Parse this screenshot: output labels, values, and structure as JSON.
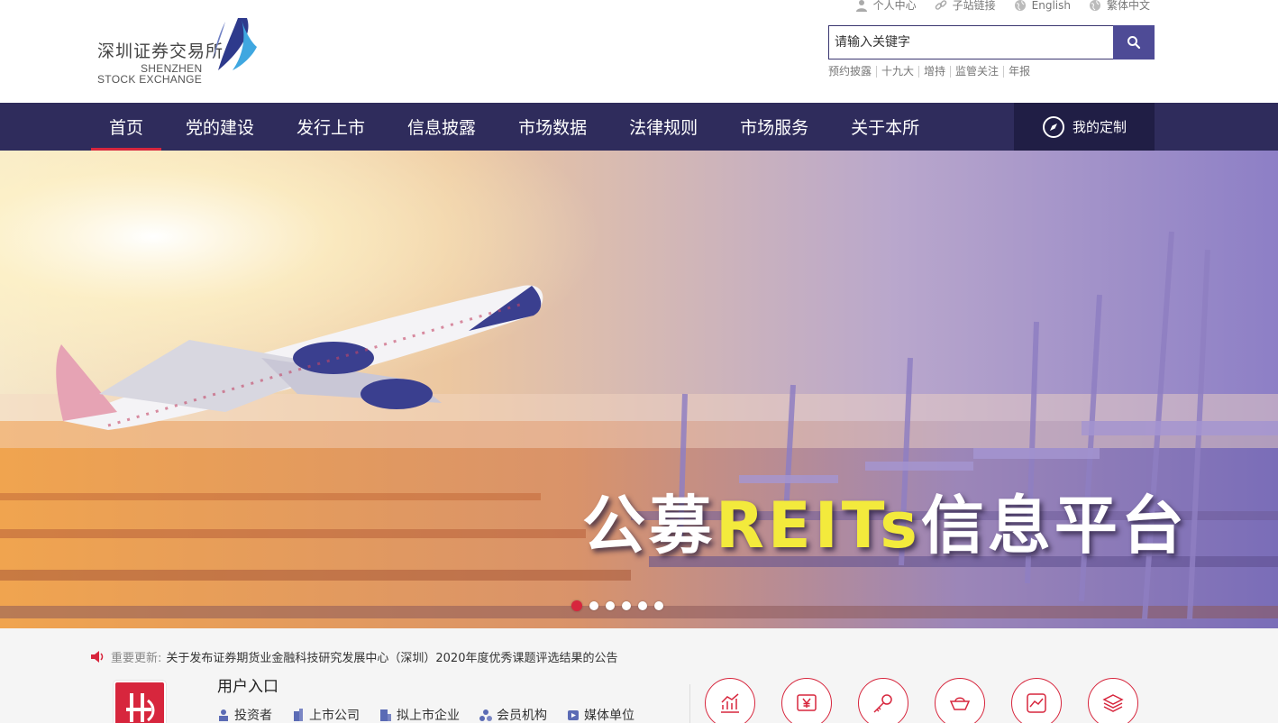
{
  "logo": {
    "cn": "深圳证券交易所",
    "en_line1": "SHENZHEN",
    "en_line2": "STOCK EXCHANGE"
  },
  "toplinks": [
    {
      "label": "个人中心",
      "icon": "user-icon"
    },
    {
      "label": "子站链接",
      "icon": "link-icon"
    },
    {
      "label": "English",
      "icon": "globe-icon"
    },
    {
      "label": "繁体中文",
      "icon": "globe-icon"
    }
  ],
  "search": {
    "placeholder": "请输入关键字",
    "button_icon": "search-icon"
  },
  "hotwords": [
    "预约披露",
    "十九大",
    "增持",
    "监管关注",
    "年报"
  ],
  "nav": {
    "items": [
      "首页",
      "党的建设",
      "发行上市",
      "信息披露",
      "市场数据",
      "法律规则",
      "市场服务",
      "关于本所"
    ],
    "active": "首页",
    "custom_label": "我的定制",
    "custom_icon": "compass-icon"
  },
  "banner": {
    "title_part1": "公募",
    "title_highlight": "REITs",
    "title_part2": "信息平台",
    "slide_count": 6,
    "active_slide": 1,
    "colors": {
      "highlight": "#f3ea3c"
    }
  },
  "notice": {
    "icon": "speaker-icon",
    "label": "重要更新:",
    "text": "关于发布证券期货业金融科技研究发展中心（深圳）2020年度优秀课题评选结果的公告"
  },
  "user_entry": {
    "title": "用户入口",
    "items": [
      {
        "label": "投资者",
        "icon": "investor-icon"
      },
      {
        "label": "上市公司",
        "icon": "building-icon"
      },
      {
        "label": "拟上市企业",
        "icon": "company-icon"
      },
      {
        "label": "会员机构",
        "icon": "members-icon"
      },
      {
        "label": "媒体单位",
        "icon": "media-icon"
      }
    ]
  },
  "quick_icons": [
    "chart-icon",
    "yen-icon",
    "key-icon",
    "ingot-icon",
    "trend-icon",
    "layers-icon"
  ],
  "colors": {
    "nav_bg": "#2f2c5c",
    "accent": "#d7263d",
    "search_btn": "#4e4b96"
  }
}
